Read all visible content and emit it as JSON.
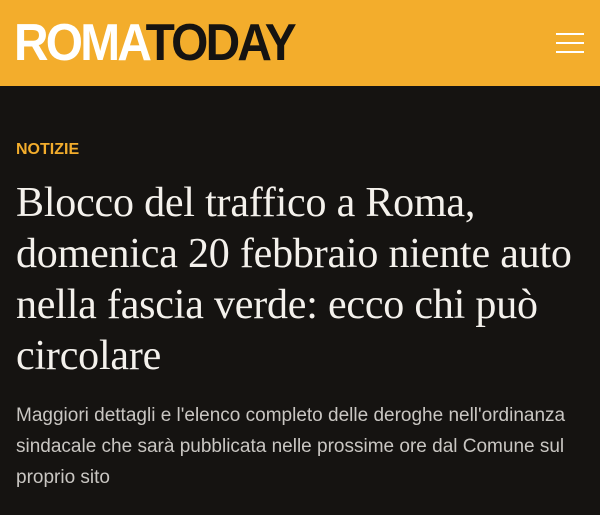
{
  "header": {
    "logo_part1": "ROMA",
    "logo_part2": "TODAY",
    "menu_icon": "hamburger-menu-icon"
  },
  "article": {
    "category": "NOTIZIE",
    "headline": "Blocco del traffico a Roma, domenica 20 febbraio niente auto nella fascia verde: ecco chi può circolare",
    "summary": "Maggiori dettagli e l'elenco completo delle deroghe nell'ordinanza sindacale che sarà pubblicata nelle prossime ore dal Comune sul proprio sito"
  },
  "colors": {
    "brand_yellow": "#f3ad2c",
    "background": "#151311",
    "headline_text": "#f4f1ec",
    "summary_text": "#c9c6c2"
  }
}
